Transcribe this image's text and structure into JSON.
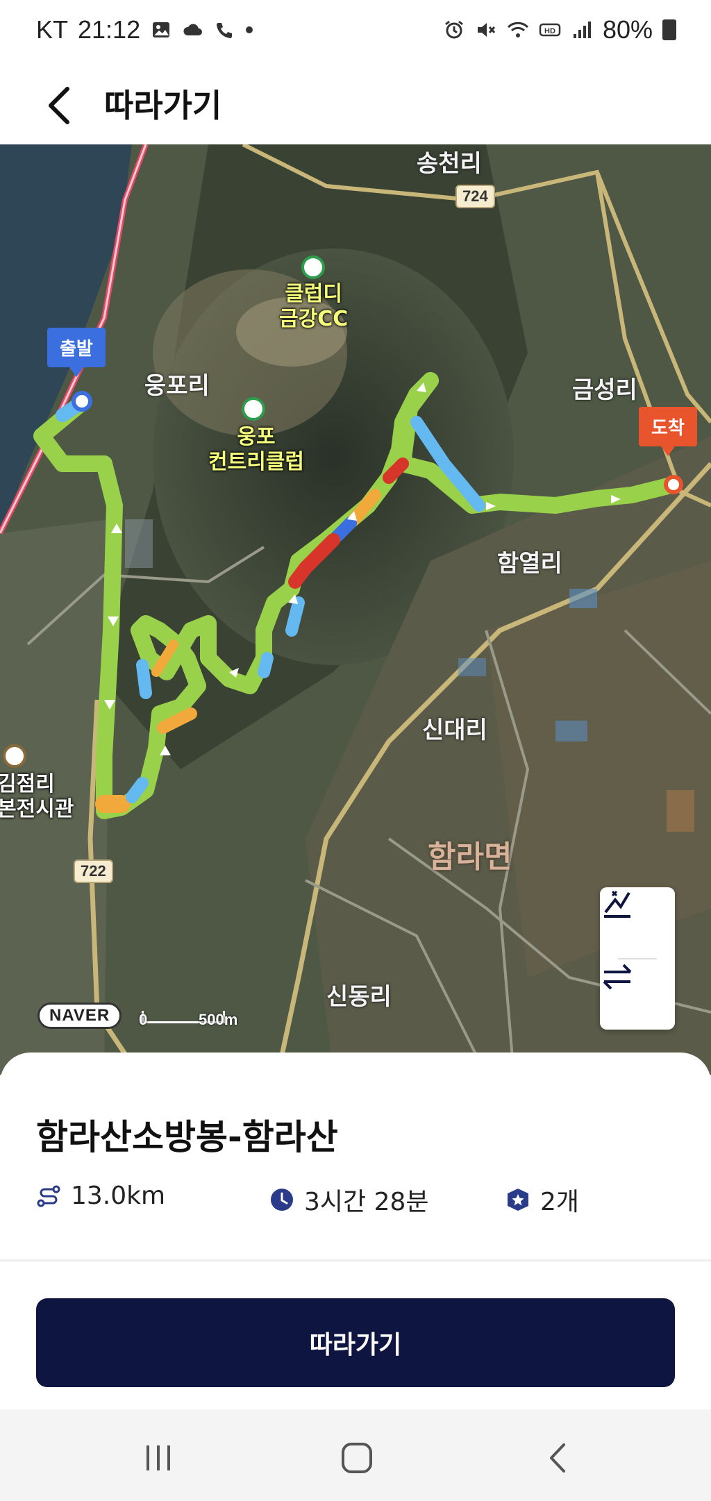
{
  "status_bar": {
    "carrier": "KT",
    "time": "21:12",
    "battery": "80%",
    "left_icons": [
      "gallery-icon",
      "cloud-icon",
      "wifi-call-icon",
      "notification-dot-icon"
    ],
    "right_icons": [
      "alarm-icon",
      "mute-icon",
      "wifi-icon",
      "hd-icon",
      "signal-icon",
      "battery-icon"
    ]
  },
  "header": {
    "back_icon": "back-arrow-icon",
    "title": "따라가기"
  },
  "map": {
    "start_label": "출발",
    "end_label": "도착",
    "place_labels": {
      "songcheon": "송천리",
      "ungpo": "웅포리",
      "geumseong": "금성리",
      "hamyeol": "함열리",
      "sindae": "신대리",
      "sindong": "신동리"
    },
    "district_label": "함라면",
    "poi": {
      "club_line1": "클럽디",
      "club_line2": "금강CC",
      "ungpo_line1": "웅포",
      "ungpo_line2": "컨트리클럽",
      "edge_line1": "김점리",
      "edge_line2": "본전시관"
    },
    "road_numbers": {
      "r724": "724",
      "r722": "722"
    },
    "provider": "NAVER",
    "scale_zero": "0",
    "scale_distance": "500m",
    "route_colors": {
      "main": "#9ad14b",
      "fast": "#63b9f0",
      "medium": "#f2a93b",
      "slow": "#d8352a"
    },
    "controls": {
      "elevation_icon": "elevation-chart-icon",
      "reverse_icon": "reverse-direction-icon"
    }
  },
  "course": {
    "title": "함라산소방봉-함라산",
    "distance": "13.0km",
    "duration": "3시간 28분",
    "checkpoints": "2개",
    "distance_icon": "route-distance-icon",
    "duration_icon": "clock-icon",
    "checkpoints_icon": "badge-star-icon",
    "follow_button": "따라가기"
  },
  "nav_bar": {
    "recent_icon": "recent-apps-icon",
    "home_icon": "home-icon",
    "back_icon": "back-icon"
  },
  "colors": {
    "button_bg": "#0e1540",
    "start_flag": "#3b6fe0",
    "end_flag": "#e8552d"
  }
}
